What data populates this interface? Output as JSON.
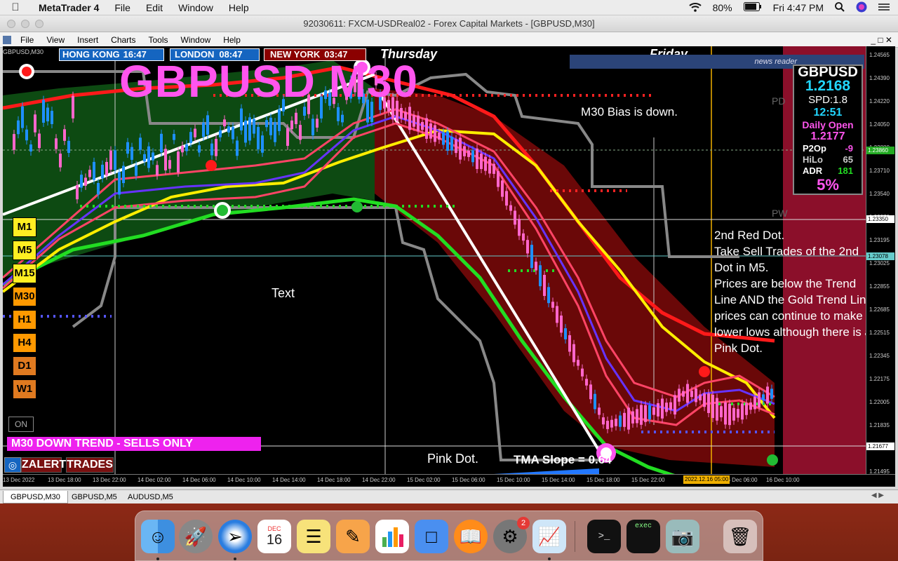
{
  "menubar": {
    "app": "MetaTrader 4",
    "items": [
      "File",
      "Edit",
      "Window",
      "Help"
    ],
    "battery": "80%",
    "clock": "Fri 4:47 PM"
  },
  "window": {
    "title": "92030611: FXCM-USDReal02 - Forex Capital Markets - [GBPUSD,M30]",
    "menu": [
      "File",
      "View",
      "Insert",
      "Charts",
      "Tools",
      "Window",
      "Help"
    ]
  },
  "chart": {
    "symbol_tag": "GBPUSD,M30",
    "big_title": "GBPUSD M30",
    "sessions": [
      {
        "name": "HONG KONG",
        "time": "16:47",
        "color": "#1565c0"
      },
      {
        "name": "LONDON",
        "time": "08:47",
        "color": "#1565c0"
      },
      {
        "name": "NEW YORK",
        "time": "03:47",
        "color": "#8b0000"
      }
    ],
    "day_labels": [
      "Thursday",
      "Friday"
    ],
    "news_reader": "news reader",
    "bias": "M30 Bias is down.",
    "pd_label": "PD",
    "pw_label": "PW",
    "text_label": "Text",
    "pink_dot": "Pink Dot.",
    "tma_slope": "TMA Slope = 0.64",
    "annotation": "2nd Red Dot.\nTake Sell Trades of the 2nd Dot in M5.\nPrices are below the Trend Line AND the Gold Trend Line, prices can continue to make lower lows although there is a Pink Dot.",
    "trend_banner": "M30  DOWN TREND - SELLS ONLY",
    "on_button": "ON",
    "alert_button": "ZALERT",
    "trades_button": "TRADES",
    "timeframes": [
      "M1",
      "M5",
      "M15",
      "M30",
      "H1",
      "H4",
      "D1",
      "W1"
    ],
    "panel": {
      "symbol": "GBPUSD",
      "price": "1.2168",
      "spread": "SPD:1.8",
      "time": "12:51",
      "daily_open_label": "Daily Open",
      "daily_open": "1.2177",
      "p2o_label": "P2Op",
      "p2o": "-9",
      "hilo_label": "HiLo",
      "hilo": "65",
      "adr_label": "ADR",
      "adr": "181",
      "pct": "5%"
    },
    "price_axis": [
      "1.24565",
      "1.24390",
      "1.24220",
      "1.24050",
      "1.23880",
      "1.23710",
      "1.23540",
      "1.23370",
      "1.23195",
      "1.23025",
      "1.22855",
      "1.22685",
      "1.22515",
      "1.22345",
      "1.22175",
      "1.22005",
      "1.21835",
      "1.21665",
      "1.21495"
    ],
    "price_tags": {
      "green": "1.23860",
      "white": "1.23350",
      "cyan": "1.23078",
      "current": "1.21677"
    },
    "time_axis": [
      "13 Dec 2022",
      "13 Dec 18:00",
      "13 Dec 22:00",
      "14 Dec 02:00",
      "14 Dec 06:00",
      "14 Dec 10:00",
      "14 Dec 14:00",
      "14 Dec 18:00",
      "14 Dec 22:00",
      "15 Dec 02:00",
      "15 Dec 06:00",
      "15 Dec 10:00",
      "15 Dec 14:00",
      "15 Dec 18:00",
      "15 Dec 22:00",
      "16 Dec 06:00",
      "16 Dec 10:00"
    ],
    "time_cursor": "2022.12.16 05:00"
  },
  "tabs": [
    "GBPUSD,M30",
    "GBPUSD,M5",
    "AUDUSD,M5"
  ],
  "dock": {
    "calendar_month": "DEC",
    "calendar_day": "16",
    "badge": "2",
    "terminal_label": "exec"
  },
  "colors": {
    "bull": "#1e90ff",
    "bear": "#ff66cc",
    "upper_band": "#ff1a1a",
    "lower_band": "#22dd22",
    "gold": "#ffee00",
    "title_pink": "#ff55ee"
  }
}
